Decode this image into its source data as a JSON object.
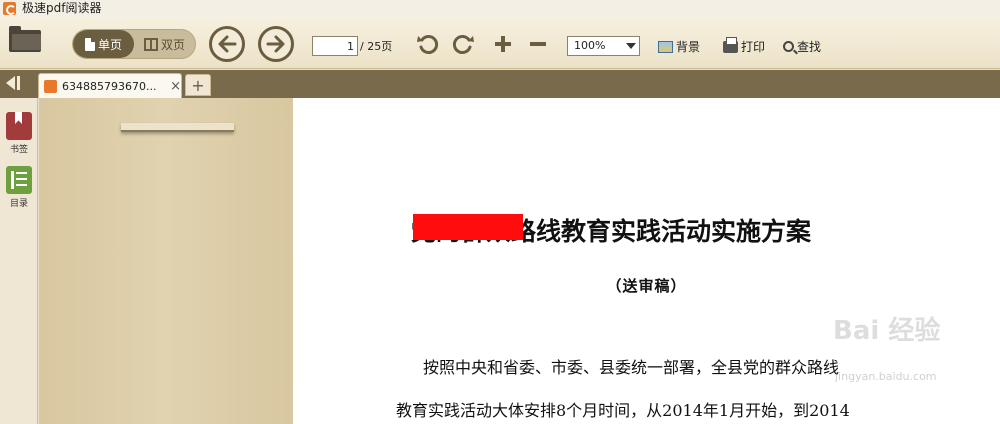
{
  "window": {
    "title": "极速pdf阅读器"
  },
  "toolbar": {
    "open_icon": "folder-icon",
    "single_page_label": "单页",
    "double_page_label": "双页",
    "prev_icon": "arrow-left-icon",
    "next_icon": "arrow-right-icon",
    "current_page": "1",
    "total_pages_label": "/ 25页",
    "rotate_left_icon": "rotate-ccw-icon",
    "rotate_right_icon": "rotate-cw-icon",
    "zoom_in_icon": "plus-icon",
    "zoom_out_icon": "minus-icon",
    "zoom_value": "100%",
    "background_label": "背景",
    "print_label": "打印",
    "find_label": "查找"
  },
  "tabs": {
    "items": [
      {
        "label": "634885793670..."
      }
    ],
    "close_glyph": "×",
    "new_tab_glyph": "+"
  },
  "rail": {
    "bookmark_label": "书签",
    "toc_label": "目录"
  },
  "document": {
    "title_visible": "党的群众路线教育实践活动实施方案",
    "subtitle": "（送审稿）",
    "lines": [
      "按照中央和省委、市委、县委统一部署，全县党的群众路线",
      "教育实践活动大体安排8个月时间，从2014年1月开始，到2014"
    ]
  },
  "watermark": {
    "text": "Bai 经验",
    "sub": "jingyan.baidu.com"
  },
  "colors": {
    "accent": "#6b5d40",
    "tabbar": "#7a6a4c",
    "redaction": "#ff0d0d",
    "bookmark": "#a23c3c",
    "toc": "#6da03f"
  }
}
